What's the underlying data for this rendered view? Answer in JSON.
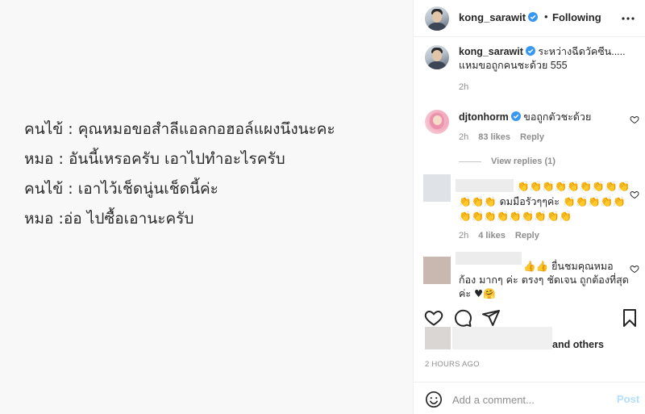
{
  "post_image": {
    "lines": [
      "คนไข้ :  คุณหมอขอสำลีแอลกอฮอล์แผงนึงนะคะ",
      "หมอ : อันนี้เหรอครับ เอาไปทำอะไรครับ",
      "คนไข้ : เอาไว้เช็ดนู่นเช็ดนี้ค่ะ",
      "หมอ :อ่อ ไปซื้อเอานะครับ"
    ]
  },
  "header": {
    "username": "kong_sarawit",
    "dot": "•",
    "follow_status": "Following",
    "more_icon": "more-horizontal-icon"
  },
  "caption": {
    "username": "kong_sarawit",
    "text": "ระหว่างฉีดวัคซีน..... แหมขอถูกคนชะด้วย 555",
    "time": "2h"
  },
  "comments": [
    {
      "username": "djtonhorm",
      "text": "ขอถูกตัวชะด้วย",
      "time": "2h",
      "likes": "83 likes",
      "reply": "Reply",
      "view_replies": "View replies (1)"
    },
    {
      "username": "",
      "line1": "👏👏👏👏👏👏👏👏👏",
      "line2": "👏👏👏 ดมมือรัวๆๆค่ะ 👏👏👏👏👏",
      "line3": "👏👏👏👏👏👏👏👏👏",
      "time": "2h",
      "likes": "4 likes",
      "reply": "Reply"
    },
    {
      "username": "",
      "line1": "👍👍 ยื่นชมคุณหมอ",
      "line2": "ก้อง มากๆ ค่ะ ตรงๆ ชัดเจน ถูกต้องที่สุด",
      "line3": "ค่ะ ♥🤗"
    }
  ],
  "likes_line": {
    "text": "and others"
  },
  "timestamp": "2 HOURS AGO",
  "add_comment": {
    "placeholder": "Add a comment...",
    "post_label": "Post"
  },
  "colors": {
    "verified": "#3897f0",
    "link_blue": "#b2dffc",
    "muted": "#8e8e8e",
    "text": "#262626"
  }
}
